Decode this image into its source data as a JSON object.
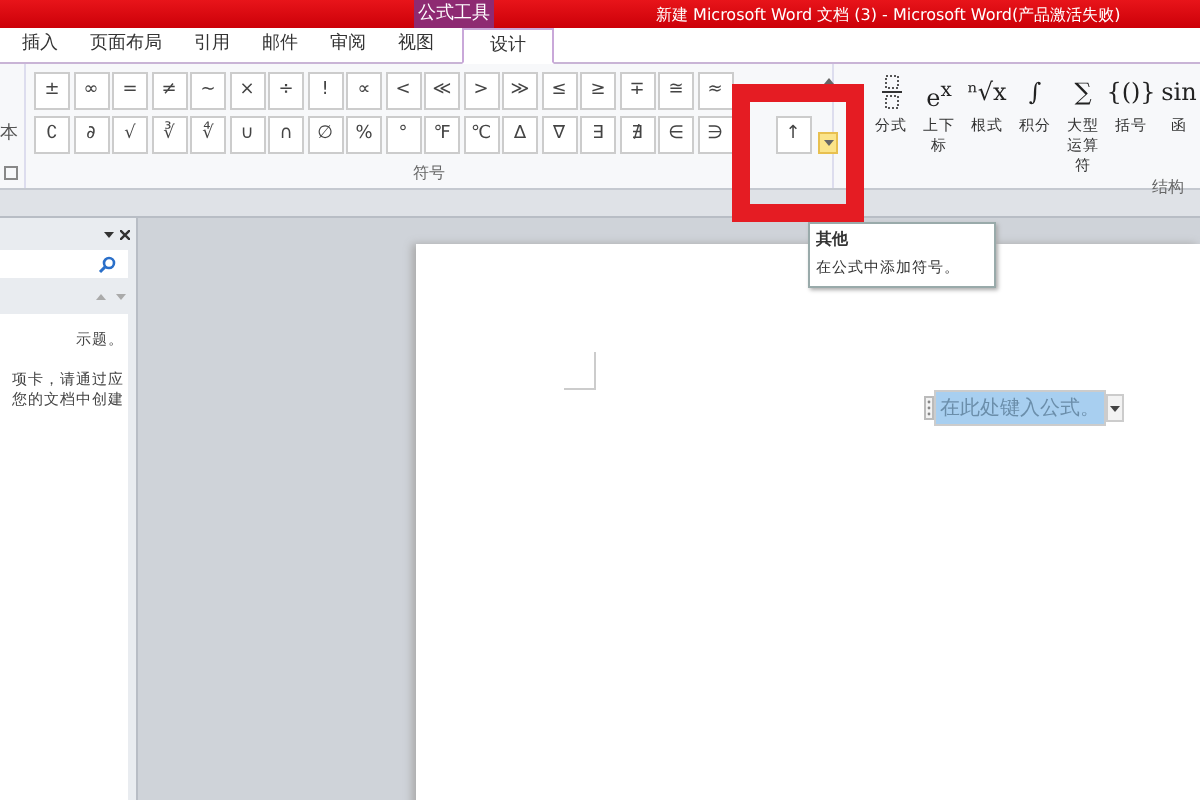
{
  "window": {
    "title": "新建 Microsoft Word 文档 (3) - Microsoft Word(产品激活失败)",
    "context_tab": "公式工具"
  },
  "tabs": [
    {
      "label": "插入",
      "selected": false
    },
    {
      "label": "页面布局",
      "selected": false
    },
    {
      "label": "引用",
      "selected": false
    },
    {
      "label": "邮件",
      "selected": false
    },
    {
      "label": "审阅",
      "selected": false
    },
    {
      "label": "视图",
      "selected": false
    },
    {
      "label": "设计",
      "selected": true
    }
  ],
  "ribbon": {
    "left_group_label": "本",
    "symbols_group": {
      "label": "符号",
      "rows": [
        [
          "±",
          "∞",
          "=",
          "≠",
          "~",
          "×",
          "÷",
          "!",
          "∝",
          "<",
          "≪",
          ">",
          "≫",
          "≤",
          "≥",
          "∓",
          "≅",
          "≈"
        ],
        [
          "∁",
          "∂",
          "√",
          "∛",
          "∜",
          "∪",
          "∩",
          "∅",
          "%",
          "°",
          "℉",
          "℃",
          "∆",
          "∇",
          "∃",
          "∄",
          "∈",
          "∋",
          "↑"
        ]
      ]
    },
    "structures_group": {
      "label": "结构",
      "items": [
        {
          "label": "分式"
        },
        {
          "label": "上下标",
          "glyph": "e$^{x}$"
        },
        {
          "label": "根式",
          "glyph": "ⁿ√x"
        },
        {
          "label": "积分",
          "glyph": "∫"
        },
        {
          "label": "大型运算符",
          "glyph": "∑"
        },
        {
          "label": "括号",
          "glyph": "{()}"
        },
        {
          "label": "函",
          "glyph": "sin"
        }
      ]
    }
  },
  "nav_pane": {
    "lines": [
      "示题。",
      "项卡，请通过应",
      "您的文档中创建"
    ]
  },
  "tooltip": {
    "title": "其他",
    "text": "在公式中添加符号。"
  },
  "equation": {
    "placeholder": "在此处键入公式。"
  }
}
